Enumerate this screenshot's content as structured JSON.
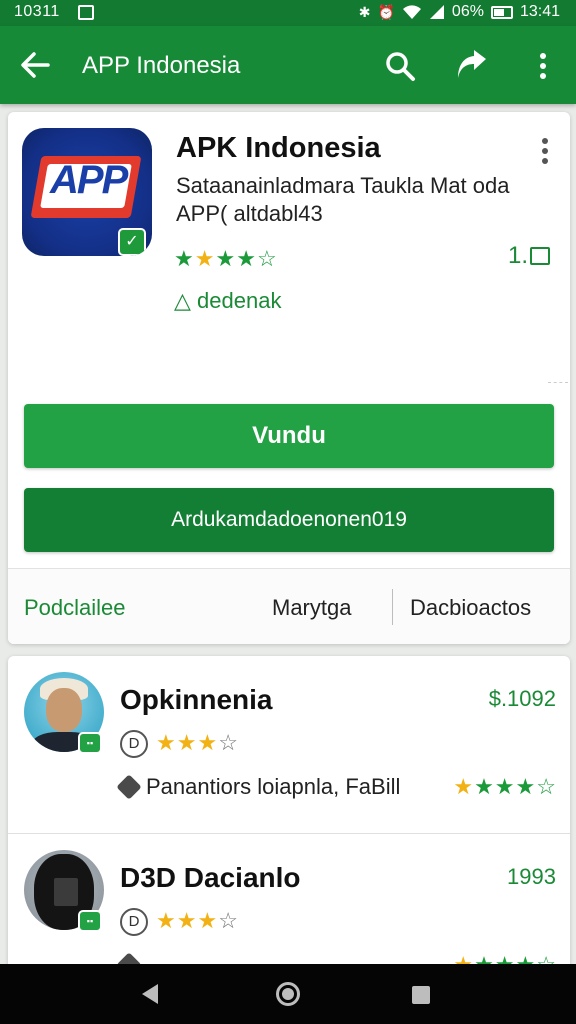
{
  "status_bar": {
    "time_left": "10311",
    "battery_percent": "06%",
    "time_right": "13:41"
  },
  "app_bar": {
    "title": "APP Indonesia"
  },
  "app": {
    "title": "APK Indonesia",
    "description": "Sataanainladmara Taukla Mat oda APP( altdabl43",
    "rating": 4.5,
    "size_label": "1.",
    "warning": "△ dedenak",
    "logo_text": "APP"
  },
  "buttons": {
    "primary": "Vundu",
    "secondary": "Ardukamdadoenonen019"
  },
  "footer": {
    "left": "Podclailee",
    "middle": "Marytga",
    "right": "Dacbioactos"
  },
  "list": [
    {
      "title": "Opkinnenia",
      "price": "$.1092",
      "badge": "D",
      "rating": 3,
      "subtitle": "Panantiors loiapnla, FaBill",
      "secondary_rating": 4.5
    },
    {
      "title": "D3D Dacianlo",
      "price": "1993",
      "badge": "D",
      "rating": 3,
      "subtitle": "",
      "secondary_rating": 4.5
    }
  ],
  "colors": {
    "primary_green": "#22a244",
    "dark_green": "#137f34",
    "app_bar_green": "#178a37",
    "star_gold": "#f2b215"
  }
}
